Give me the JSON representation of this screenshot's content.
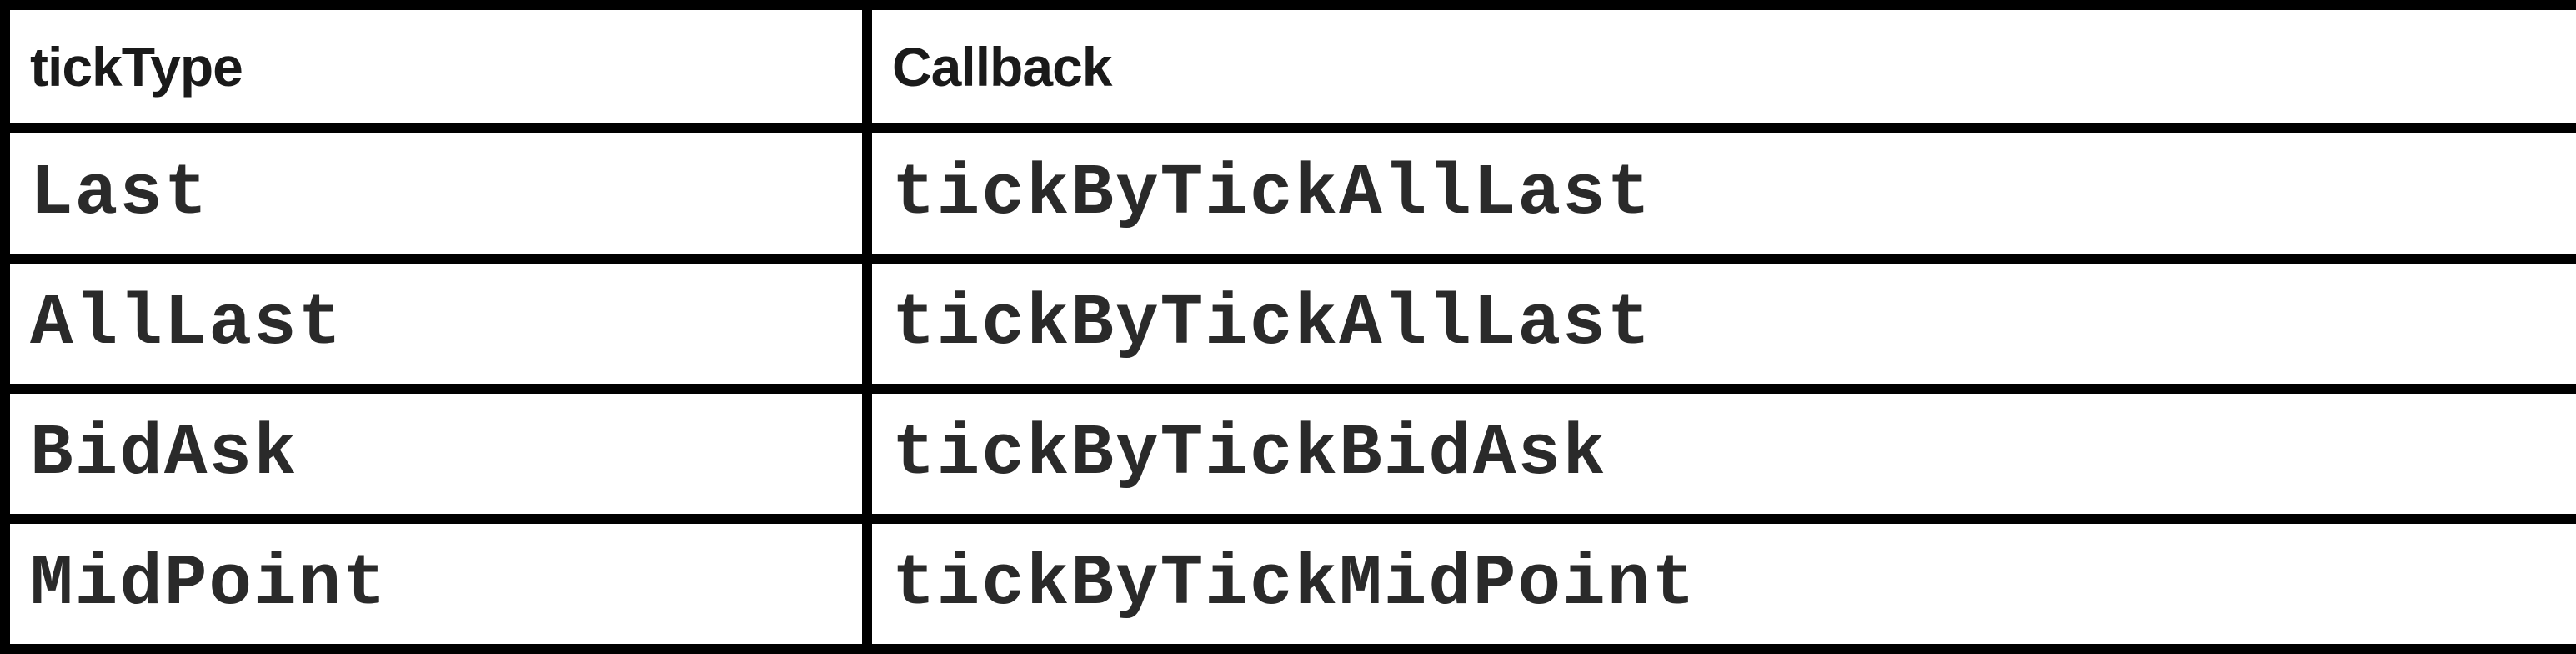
{
  "table": {
    "headers": [
      "tickType",
      "Callback"
    ],
    "rows": [
      [
        "Last",
        "tickByTickAllLast"
      ],
      [
        "AllLast",
        "tickByTickAllLast"
      ],
      [
        "BidAsk",
        "tickByTickBidAsk"
      ],
      [
        "MidPoint",
        "tickByTickMidPoint"
      ]
    ]
  }
}
